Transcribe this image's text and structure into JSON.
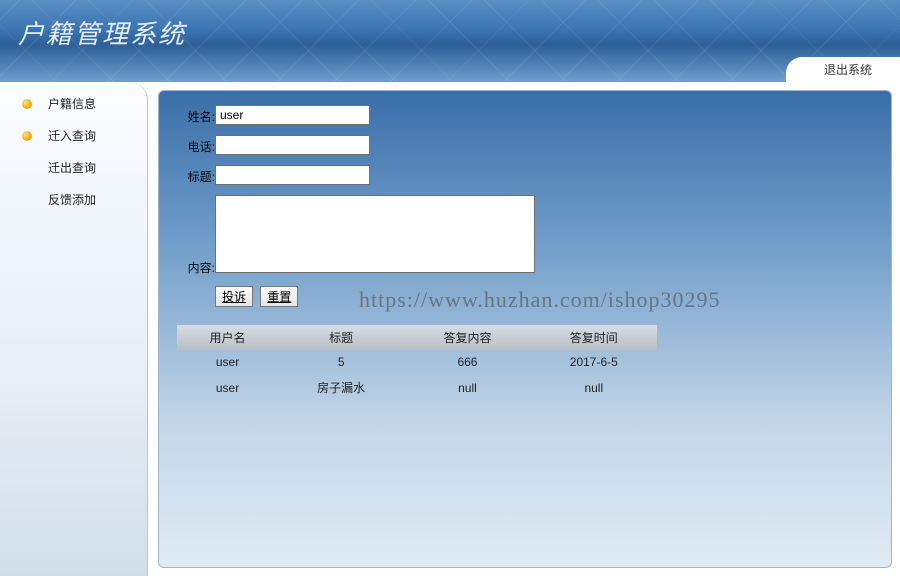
{
  "header": {
    "title": "户籍管理系统",
    "logout": "退出系统"
  },
  "sidebar": {
    "items": [
      {
        "label": "户籍信息",
        "bullet": true
      },
      {
        "label": "迁入查询",
        "bullet": true
      },
      {
        "label": "迁出查询",
        "bullet": false
      },
      {
        "label": "反馈添加",
        "bullet": false
      }
    ]
  },
  "form": {
    "name_label": "姓名:",
    "name_value": "user",
    "phone_label": "电话:",
    "phone_value": "",
    "title_label": "标题:",
    "title_value": "",
    "content_label": "内容:",
    "content_value": "",
    "submit_btn": "投诉",
    "reset_btn": "重置"
  },
  "table": {
    "headers": [
      "用户名",
      "标题",
      "答复内容",
      "答复时间"
    ],
    "rows": [
      {
        "c0": "user",
        "c1": "5",
        "c2": "666",
        "c3": "2017-6-5"
      },
      {
        "c0": "user",
        "c1": "房子漏水",
        "c2": "null",
        "c3": "null"
      }
    ]
  },
  "watermark": "https://www.huzhan.com/ishop30295"
}
